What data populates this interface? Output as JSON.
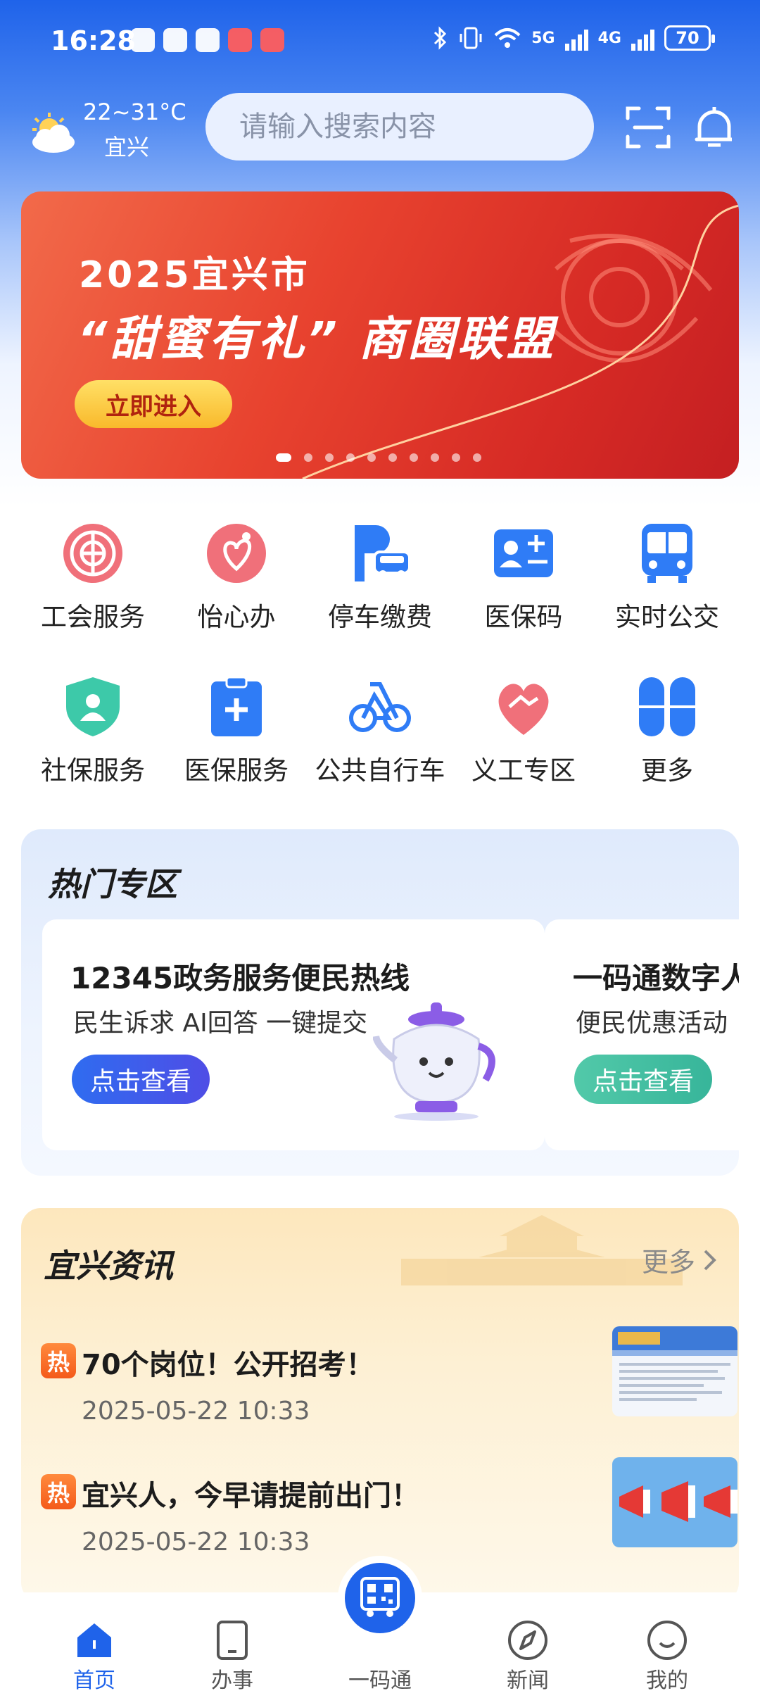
{
  "status_bar": {
    "time": "16:28",
    "network_5g": "5G",
    "network_4g": "4G",
    "battery": "70"
  },
  "header": {
    "weather_temp": "22~31°C",
    "weather_city": "宜兴",
    "search_placeholder": "请输入搜索内容",
    "scan_icon": "scan-icon",
    "bell_icon": "bell-icon"
  },
  "banner": {
    "line1": "2025宜兴市",
    "line2": "“甜蜜有礼” 商圈联盟",
    "button": "立即进入",
    "page_count": 10,
    "active_page": 1
  },
  "services": [
    {
      "label": "工会服务",
      "icon": "union-emblem-icon"
    },
    {
      "label": "怡心办",
      "icon": "heart-person-icon"
    },
    {
      "label": "停车缴费",
      "icon": "parking-car-icon"
    },
    {
      "label": "医保码",
      "icon": "medical-card-icon"
    },
    {
      "label": "实时公交",
      "icon": "bus-icon"
    },
    {
      "label": "社保服务",
      "icon": "shield-user-icon"
    },
    {
      "label": "医保服务",
      "icon": "medical-clipboard-icon"
    },
    {
      "label": "公共自行车",
      "icon": "bicycle-icon"
    },
    {
      "label": "义工专区",
      "icon": "handshake-heart-icon"
    },
    {
      "label": "更多",
      "icon": "grid-more-icon"
    }
  ],
  "hot_zone": {
    "title": "热门专区",
    "cards": [
      {
        "title": "12345政务服务便民热线",
        "subtitle": "民生诉求 AI回答 一键提交",
        "button": "点击查看"
      },
      {
        "title": "一码通数字人",
        "subtitle": "便民优惠活动",
        "button": "点击查看"
      }
    ]
  },
  "news": {
    "title": "宜兴资讯",
    "more": "更多",
    "items": [
      {
        "tag": "热",
        "title": "70个岗位！公开招考！",
        "date": "2025-05-22 10:33"
      },
      {
        "tag": "热",
        "title": "宜兴人，今早请提前出门！",
        "date": "2025-05-22 10:33"
      }
    ]
  },
  "tabbar": {
    "tabs": [
      {
        "label": "首页",
        "icon": "home-icon"
      },
      {
        "label": "办事",
        "icon": "tablet-icon"
      },
      {
        "label": "一码通",
        "icon": "qr-bus-icon"
      },
      {
        "label": "新闻",
        "icon": "compass-icon"
      },
      {
        "label": "我的",
        "icon": "smile-icon"
      }
    ],
    "active": "首页"
  },
  "colors": {
    "primary": "#1f63ea",
    "banner_red": "#e8432f",
    "accent_orange": "#f45a1a",
    "teal_button": "#37c4a4"
  }
}
